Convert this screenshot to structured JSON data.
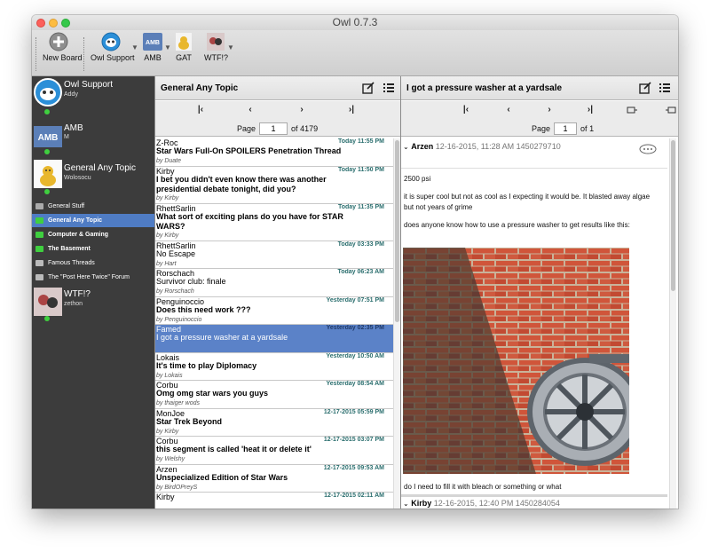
{
  "window": {
    "title": "Owl 0.7.3"
  },
  "toolbar": {
    "items": [
      {
        "label": "New Board",
        "icon": "plus-icon"
      },
      {
        "label": "Owl Support",
        "icon": "owl-icon"
      },
      {
        "label": "AMB",
        "icon": "amb-logo-icon"
      },
      {
        "label": "GAT",
        "icon": "gat-icon"
      },
      {
        "label": "WTF!?",
        "icon": "wtf-icon"
      }
    ],
    "caret": "▼"
  },
  "sidebar": {
    "accounts": [
      {
        "name": "Owl Support",
        "user": "Addy"
      },
      {
        "name": "AMB",
        "user": "M"
      },
      {
        "name": "General Any Topic",
        "user": "Wolosocu"
      },
      {
        "name": "WTF!?",
        "user": "zethon"
      }
    ],
    "forums": [
      {
        "label": "General Stuff"
      },
      {
        "label": "General Any Topic"
      },
      {
        "label": "Computer & Gaming"
      },
      {
        "label": "The Basement"
      },
      {
        "label": "Famous Threads"
      },
      {
        "label": "The \"Post Here Twice\" Forum"
      }
    ]
  },
  "threads_pane": {
    "title": "General Any Topic",
    "page_label": "Page",
    "page_value": "1",
    "of_label": "of",
    "total_pages": "4179",
    "nav": {
      "first": "|‹",
      "prev": "‹",
      "next": "›",
      "last": "›|"
    },
    "threads": [
      {
        "author": "Z-Roc",
        "date": "Today 11:55 PM",
        "title": "Star Wars Full-On SPOILERS Penetration Thread",
        "by": "by Duate",
        "bold": true
      },
      {
        "author": "Kirby",
        "date": "Today 11:50 PM",
        "title": "I bet you didn't even know there was another",
        "title2": "presidential debate tonight, did you?",
        "by": "by Kirby",
        "bold": true
      },
      {
        "author": "RhettSarlin",
        "date": "Today 11:35 PM",
        "title": "What sort of exciting plans do you have for STAR",
        "title2": "WARS?",
        "by": "by Kirby",
        "bold": true
      },
      {
        "author": "RhettSarlin",
        "date": "Today 03:33 PM",
        "title": "No Escape",
        "by": "by Hart",
        "bold": false
      },
      {
        "author": "Rorschach",
        "date": "Today 06:23 AM",
        "title": "Survivor club: finale",
        "by": "by Rorschach",
        "bold": false
      },
      {
        "author": "Penguinoccio",
        "date": "Yesterday 07:51 PM",
        "title": "Does this need work ???",
        "by": "by Penguinoccio",
        "bold": true
      },
      {
        "author": "Famed",
        "date": "Yesterday 02:35 PM",
        "title": "I got a pressure washer at a yardsale",
        "by": "",
        "bold": false
      },
      {
        "author": "Lokais",
        "date": "Yesterday 10:50 AM",
        "title": "It's time to play Diplomacy",
        "by": "by Lokais",
        "bold": true
      },
      {
        "author": "Corbu",
        "date": "Yesterday 08:54 AM",
        "title": "Omg omg star wars you guys",
        "by": "by thaiger wods",
        "bold": true
      },
      {
        "author": "MonJoe",
        "date": "12-17-2015 05:59 PM",
        "title": "Star Trek Beyond",
        "by": "by Kirby",
        "bold": true
      },
      {
        "author": "Corbu",
        "date": "12-17-2015 03:07 PM",
        "title": "this segment is called 'heat it or delete it'",
        "by": "by Welshy",
        "bold": true
      },
      {
        "author": "Arzen",
        "date": "12-17-2015 09:53 AM",
        "title": "Unspecialized Edition of Star Wars",
        "by": "by BirdOPreyS",
        "bold": true
      },
      {
        "author": "Kirby",
        "date": "12-17-2015 02:11 AM",
        "title": "",
        "by": "",
        "bold": true
      }
    ]
  },
  "post_pane": {
    "title": "I got a pressure washer at a yardsale",
    "page_label": "Page",
    "page_value": "1",
    "of_label": "of",
    "total_pages": "1",
    "posts": [
      {
        "author": "Arzen",
        "meta": "12-16-2015, 11:28 AM 1450279710",
        "lines": [
          "2500 psi",
          "it is super cool but not as cool as I expecting it would be. It blasted away algae but not years of grime",
          "does anyone know how to use a pressure washer to get results like this:",
          "do I need to fill it with bleach or something or what"
        ]
      },
      {
        "author": "Kirby",
        "meta": "12-16-2015, 12:40 PM 1450284054"
      }
    ]
  },
  "colors": {
    "selection": "#4f7cc4",
    "sidebar_bg": "#3c3c3c",
    "online": "#3fcf3f",
    "date": "#2a6e6e"
  }
}
